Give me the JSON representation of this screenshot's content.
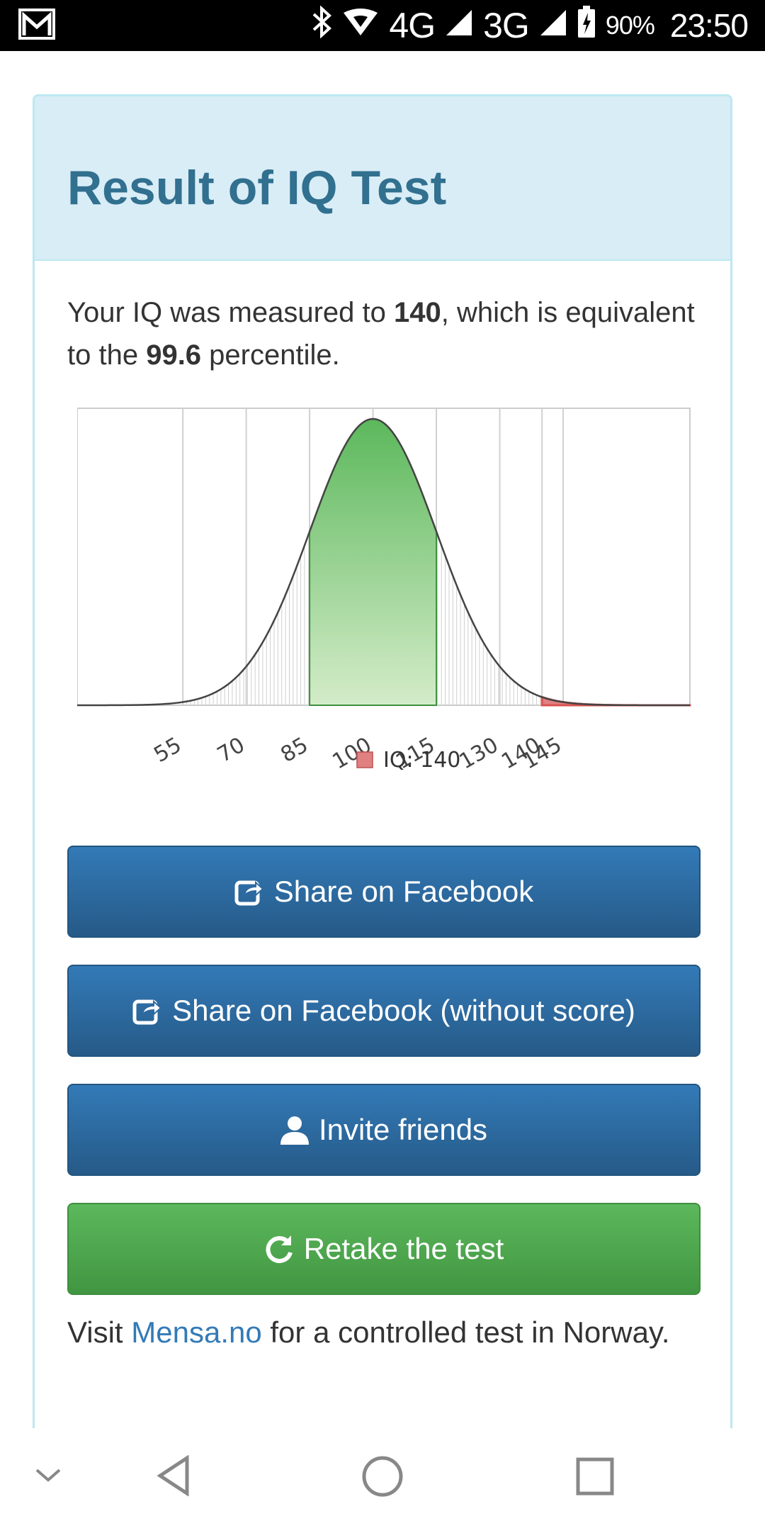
{
  "status_bar": {
    "network_1": "4G",
    "network_2": "3G",
    "battery": "90%",
    "time": "23:50"
  },
  "panel": {
    "title": "Result of IQ Test",
    "result": {
      "prefix": "Your IQ was measured to ",
      "iq": "140",
      "middle": ", which is equivalent to the ",
      "percentile": "99.6",
      "suffix": " percentile."
    }
  },
  "chart_data": {
    "type": "area",
    "title": "",
    "xlabel": "",
    "ylabel": "",
    "distribution": "normal",
    "mean": 100,
    "sd": 15,
    "x_range": [
      30,
      175
    ],
    "tick_labels": [
      "55",
      "70",
      "85",
      "100",
      "115",
      "130",
      "140",
      "145"
    ],
    "gridlines": [
      55,
      70,
      85,
      100,
      115,
      130,
      140,
      145
    ],
    "highlight_range": [
      85,
      115
    ],
    "marked_tail_from": 140,
    "legend": [
      {
        "name": "IQ: 140",
        "color": "#e08080"
      }
    ],
    "legend_position": "bottom",
    "colors": {
      "highlight": "#5cb85c",
      "tail": "#d9534f",
      "curve": "#444444"
    }
  },
  "buttons": {
    "share_facebook": "Share on Facebook",
    "share_facebook_no_score": "Share on Facebook (without score)",
    "invite_friends": "Invite friends",
    "retake": "Retake the test"
  },
  "footer": {
    "prefix": "Visit ",
    "link": "Mensa.no",
    "suffix": " for a controlled test in Norway."
  },
  "icons": {
    "share": "share-icon",
    "user": "user-icon",
    "refresh": "refresh-icon",
    "back": "back-icon",
    "home": "home-icon",
    "recents": "recents-icon",
    "hide": "chevron-down-icon"
  }
}
